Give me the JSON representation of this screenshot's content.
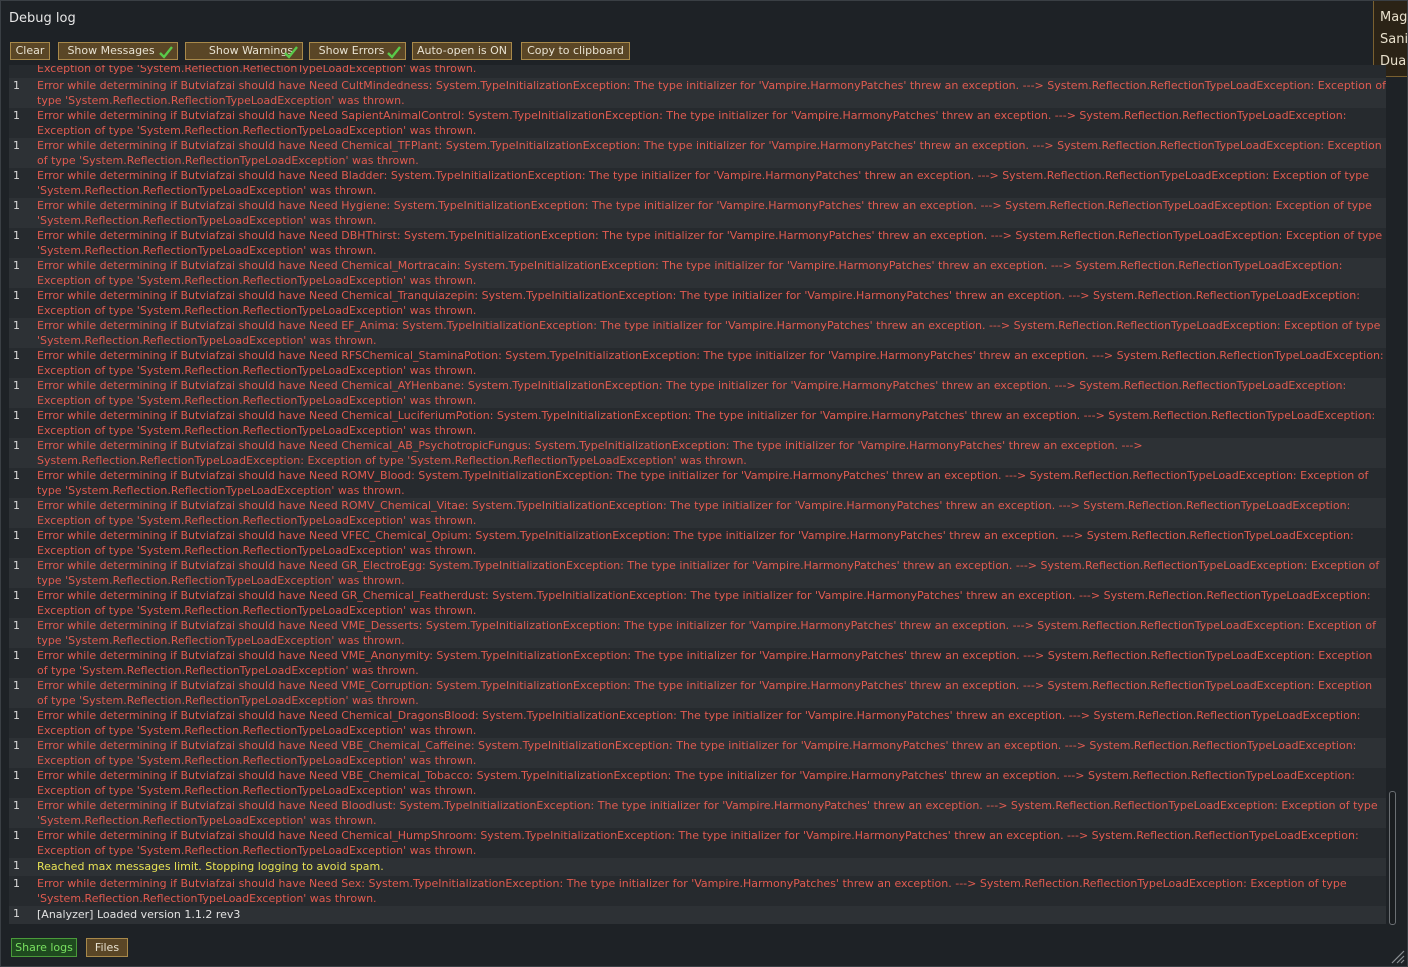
{
  "window": {
    "title": "Debug log",
    "side_tab_lines": [
      "Mag",
      "Sani",
      "Dua"
    ]
  },
  "toolbar": {
    "clear": "Clear",
    "show_messages": "Show Messages",
    "show_warnings": "Show Warnings",
    "show_errors": "Show Errors",
    "auto_open": "Auto-open is ON",
    "copy": "Copy to clipboard",
    "check_color": "#59c94a"
  },
  "log": {
    "partial_top": "Exception of type 'System.Reflection.ReflectionTypeLoadException' was thrown.",
    "entries": [
      {
        "count": "1",
        "type": "error",
        "text": "Error while determining if Butviafzai should have Need CultMindedness: System.TypeInitializationException: The type initializer for 'Vampire.HarmonyPatches' threw an exception. ---> System.Reflection.ReflectionTypeLoadException: Exception of type 'System.Reflection.ReflectionTypeLoadException' was thrown."
      },
      {
        "count": "1",
        "type": "error",
        "text": "Error while determining if Butviafzai should have Need SapientAnimalControl: System.TypeInitializationException: The type initializer for 'Vampire.HarmonyPatches' threw an exception. ---> System.Reflection.ReflectionTypeLoadException: Exception of type 'System.Reflection.ReflectionTypeLoadException' was thrown."
      },
      {
        "count": "1",
        "type": "error",
        "text": "Error while determining if Butviafzai should have Need Chemical_TFPlant: System.TypeInitializationException: The type initializer for 'Vampire.HarmonyPatches' threw an exception. ---> System.Reflection.ReflectionTypeLoadException: Exception of type 'System.Reflection.ReflectionTypeLoadException' was thrown."
      },
      {
        "count": "1",
        "type": "error",
        "text": "Error while determining if Butviafzai should have Need Bladder: System.TypeInitializationException: The type initializer for 'Vampire.HarmonyPatches' threw an exception. ---> System.Reflection.ReflectionTypeLoadException: Exception of type 'System.Reflection.ReflectionTypeLoadException' was thrown."
      },
      {
        "count": "1",
        "type": "error",
        "text": "Error while determining if Butviafzai should have Need Hygiene: System.TypeInitializationException: The type initializer for 'Vampire.HarmonyPatches' threw an exception. ---> System.Reflection.ReflectionTypeLoadException: Exception of type 'System.Reflection.ReflectionTypeLoadException' was thrown."
      },
      {
        "count": "1",
        "type": "error",
        "text": "Error while determining if Butviafzai should have Need DBHThirst: System.TypeInitializationException: The type initializer for 'Vampire.HarmonyPatches' threw an exception. ---> System.Reflection.ReflectionTypeLoadException: Exception of type 'System.Reflection.ReflectionTypeLoadException' was thrown."
      },
      {
        "count": "1",
        "type": "error",
        "text": "Error while determining if Butviafzai should have Need Chemical_Mortracain: System.TypeInitializationException: The type initializer for 'Vampire.HarmonyPatches' threw an exception. ---> System.Reflection.ReflectionTypeLoadException: Exception of type 'System.Reflection.ReflectionTypeLoadException' was thrown."
      },
      {
        "count": "1",
        "type": "error",
        "text": "Error while determining if Butviafzai should have Need Chemical_Tranquiazepin: System.TypeInitializationException: The type initializer for 'Vampire.HarmonyPatches' threw an exception. ---> System.Reflection.ReflectionTypeLoadException: Exception of type 'System.Reflection.ReflectionTypeLoadException' was thrown."
      },
      {
        "count": "1",
        "type": "error",
        "text": "Error while determining if Butviafzai should have Need EF_Anima: System.TypeInitializationException: The type initializer for 'Vampire.HarmonyPatches' threw an exception. ---> System.Reflection.ReflectionTypeLoadException: Exception of type 'System.Reflection.ReflectionTypeLoadException' was thrown."
      },
      {
        "count": "1",
        "type": "error",
        "text": "Error while determining if Butviafzai should have Need RFSChemical_StaminaPotion: System.TypeInitializationException: The type initializer for 'Vampire.HarmonyPatches' threw an exception. ---> System.Reflection.ReflectionTypeLoadException: Exception of type 'System.Reflection.ReflectionTypeLoadException' was thrown."
      },
      {
        "count": "1",
        "type": "error",
        "text": "Error while determining if Butviafzai should have Need Chemical_AYHenbane: System.TypeInitializationException: The type initializer for 'Vampire.HarmonyPatches' threw an exception. ---> System.Reflection.ReflectionTypeLoadException: Exception of type 'System.Reflection.ReflectionTypeLoadException' was thrown."
      },
      {
        "count": "1",
        "type": "error",
        "text": "Error while determining if Butviafzai should have Need Chemical_LuciferiumPotion: System.TypeInitializationException: The type initializer for 'Vampire.HarmonyPatches' threw an exception. ---> System.Reflection.ReflectionTypeLoadException: Exception of type 'System.Reflection.ReflectionTypeLoadException' was thrown."
      },
      {
        "count": "1",
        "type": "error",
        "text": "Error while determining if Butviafzai should have Need Chemical_AB_PsychotropicFungus: System.TypeInitializationException: The type initializer for 'Vampire.HarmonyPatches' threw an exception. ---> System.Reflection.ReflectionTypeLoadException: Exception of type 'System.Reflection.ReflectionTypeLoadException' was thrown."
      },
      {
        "count": "1",
        "type": "error",
        "text": "Error while determining if Butviafzai should have Need ROMV_Blood: System.TypeInitializationException: The type initializer for 'Vampire.HarmonyPatches' threw an exception. ---> System.Reflection.ReflectionTypeLoadException: Exception of type 'System.Reflection.ReflectionTypeLoadException' was thrown."
      },
      {
        "count": "1",
        "type": "error",
        "text": "Error while determining if Butviafzai should have Need ROMV_Chemical_Vitae: System.TypeInitializationException: The type initializer for 'Vampire.HarmonyPatches' threw an exception. ---> System.Reflection.ReflectionTypeLoadException: Exception of type 'System.Reflection.ReflectionTypeLoadException' was thrown."
      },
      {
        "count": "1",
        "type": "error",
        "text": "Error while determining if Butviafzai should have Need VFEC_Chemical_Opium: System.TypeInitializationException: The type initializer for 'Vampire.HarmonyPatches' threw an exception. ---> System.Reflection.ReflectionTypeLoadException: Exception of type 'System.Reflection.ReflectionTypeLoadException' was thrown."
      },
      {
        "count": "1",
        "type": "error",
        "text": "Error while determining if Butviafzai should have Need GR_ElectroEgg: System.TypeInitializationException: The type initializer for 'Vampire.HarmonyPatches' threw an exception. ---> System.Reflection.ReflectionTypeLoadException: Exception of type 'System.Reflection.ReflectionTypeLoadException' was thrown."
      },
      {
        "count": "1",
        "type": "error",
        "text": "Error while determining if Butviafzai should have Need GR_Chemical_Featherdust: System.TypeInitializationException: The type initializer for 'Vampire.HarmonyPatches' threw an exception. ---> System.Reflection.ReflectionTypeLoadException: Exception of type 'System.Reflection.ReflectionTypeLoadException' was thrown."
      },
      {
        "count": "1",
        "type": "error",
        "text": "Error while determining if Butviafzai should have Need VME_Desserts: System.TypeInitializationException: The type initializer for 'Vampire.HarmonyPatches' threw an exception. ---> System.Reflection.ReflectionTypeLoadException: Exception of type 'System.Reflection.ReflectionTypeLoadException' was thrown."
      },
      {
        "count": "1",
        "type": "error",
        "text": "Error while determining if Butviafzai should have Need VME_Anonymity: System.TypeInitializationException: The type initializer for 'Vampire.HarmonyPatches' threw an exception. ---> System.Reflection.ReflectionTypeLoadException: Exception of type 'System.Reflection.ReflectionTypeLoadException' was thrown."
      },
      {
        "count": "1",
        "type": "error",
        "text": "Error while determining if Butviafzai should have Need VME_Corruption: System.TypeInitializationException: The type initializer for 'Vampire.HarmonyPatches' threw an exception. ---> System.Reflection.ReflectionTypeLoadException: Exception of type 'System.Reflection.ReflectionTypeLoadException' was thrown."
      },
      {
        "count": "1",
        "type": "error",
        "text": "Error while determining if Butviafzai should have Need Chemical_DragonsBlood: System.TypeInitializationException: The type initializer for 'Vampire.HarmonyPatches' threw an exception. ---> System.Reflection.ReflectionTypeLoadException: Exception of type 'System.Reflection.ReflectionTypeLoadException' was thrown."
      },
      {
        "count": "1",
        "type": "error",
        "text": "Error while determining if Butviafzai should have Need VBE_Chemical_Caffeine: System.TypeInitializationException: The type initializer for 'Vampire.HarmonyPatches' threw an exception. ---> System.Reflection.ReflectionTypeLoadException: Exception of type 'System.Reflection.ReflectionTypeLoadException' was thrown."
      },
      {
        "count": "1",
        "type": "error",
        "text": "Error while determining if Butviafzai should have Need VBE_Chemical_Tobacco: System.TypeInitializationException: The type initializer for 'Vampire.HarmonyPatches' threw an exception. ---> System.Reflection.ReflectionTypeLoadException: Exception of type 'System.Reflection.ReflectionTypeLoadException' was thrown."
      },
      {
        "count": "1",
        "type": "error",
        "text": "Error while determining if Butviafzai should have Need Bloodlust: System.TypeInitializationException: The type initializer for 'Vampire.HarmonyPatches' threw an exception. ---> System.Reflection.ReflectionTypeLoadException: Exception of type 'System.Reflection.ReflectionTypeLoadException' was thrown."
      },
      {
        "count": "1",
        "type": "error",
        "text": "Error while determining if Butviafzai should have Need Chemical_HumpShroom: System.TypeInitializationException: The type initializer for 'Vampire.HarmonyPatches' threw an exception. ---> System.Reflection.ReflectionTypeLoadException: Exception of type 'System.Reflection.ReflectionTypeLoadException' was thrown."
      },
      {
        "count": "1",
        "type": "warn",
        "text": "Reached max messages limit. Stopping logging to avoid spam."
      },
      {
        "count": "1",
        "type": "error",
        "text": "Error while determining if Butviafzai should have Need Sex: System.TypeInitializationException: The type initializer for 'Vampire.HarmonyPatches' threw an exception. ---> System.Reflection.ReflectionTypeLoadException: Exception of type 'System.Reflection.ReflectionTypeLoadException' was thrown."
      },
      {
        "count": "1",
        "type": "info",
        "text": "[Analyzer] Loaded version 1.1.2 rev3"
      }
    ]
  },
  "bottom": {
    "share_logs": "Share logs",
    "files": "Files"
  },
  "colors": {
    "error": "#e05b50",
    "warning": "#e8e254",
    "info": "#e2e2e2",
    "button_fill": "#5a4626",
    "button_border": "#a8894a",
    "share_fill": "#1f4a1f",
    "share_text": "#78e060"
  }
}
